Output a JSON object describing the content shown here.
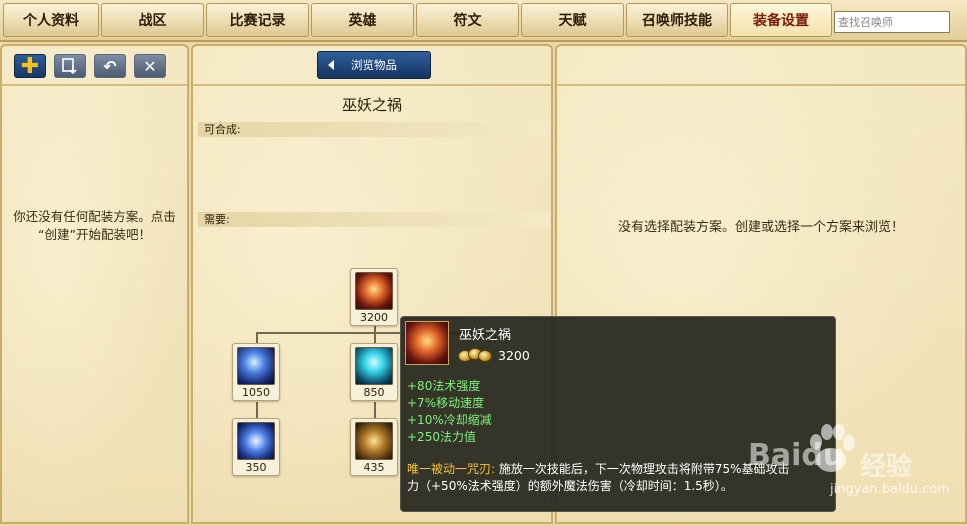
{
  "tabs": [
    {
      "label": "个人资料"
    },
    {
      "label": "战区"
    },
    {
      "label": "比赛记录"
    },
    {
      "label": "英雄"
    },
    {
      "label": "符文"
    },
    {
      "label": "天赋"
    },
    {
      "label": "召唤师技能"
    },
    {
      "label": "装备设置",
      "active": true
    }
  ],
  "search": {
    "placeholder": "查找召唤师",
    "value": ""
  },
  "left_panel": {
    "toolbar": [
      {
        "name": "create-set-button",
        "glyph": "+"
      },
      {
        "name": "save-set-button",
        "glyph": "⇩"
      },
      {
        "name": "undo-button",
        "glyph": "↶"
      },
      {
        "name": "delete-set-button",
        "glyph": "✕"
      }
    ],
    "empty_message_line1": "你还没有任何配装方案。点击",
    "empty_message_line2": "“创建”开始配装吧！"
  },
  "middle_panel": {
    "browse_button": "浏览物品",
    "item_title": "巫妖之祸",
    "builds_into_label": "可合成:",
    "requires_label": "需要:",
    "recipe_tree": {
      "root": {
        "price": "3200",
        "icon": "lich-bane-icon"
      },
      "components": [
        {
          "price": "1050",
          "icon": "aether-wisp-icon"
        },
        {
          "price": "850",
          "icon": "sheen-icon"
        },
        {
          "price": "350",
          "icon": "sapphire-crystal-icon"
        },
        {
          "price": "435",
          "icon": "amplifying-tome-icon"
        }
      ]
    }
  },
  "right_panel": {
    "empty_message": "没有选择配装方案。创建或选择一个方案来浏览！"
  },
  "tooltip": {
    "name": "巫妖之祸",
    "price": "3200",
    "stats": [
      "+80法术强度",
      "+7%移动速度",
      "+10%冷却缩减",
      "+250法力值"
    ],
    "passive_name": "唯一被动一咒刃:",
    "passive_text_1": " 施放一次技能后，下一次物理攻击将附带75%基础攻击",
    "passive_text_2": "力（+50%法术强度）的额外魔法伤害（冷却时间：1.5秒）。"
  },
  "watermark": {
    "brand": "Baidu",
    "brand_cn": "经验",
    "url": "jingyan.baidu.com"
  }
}
